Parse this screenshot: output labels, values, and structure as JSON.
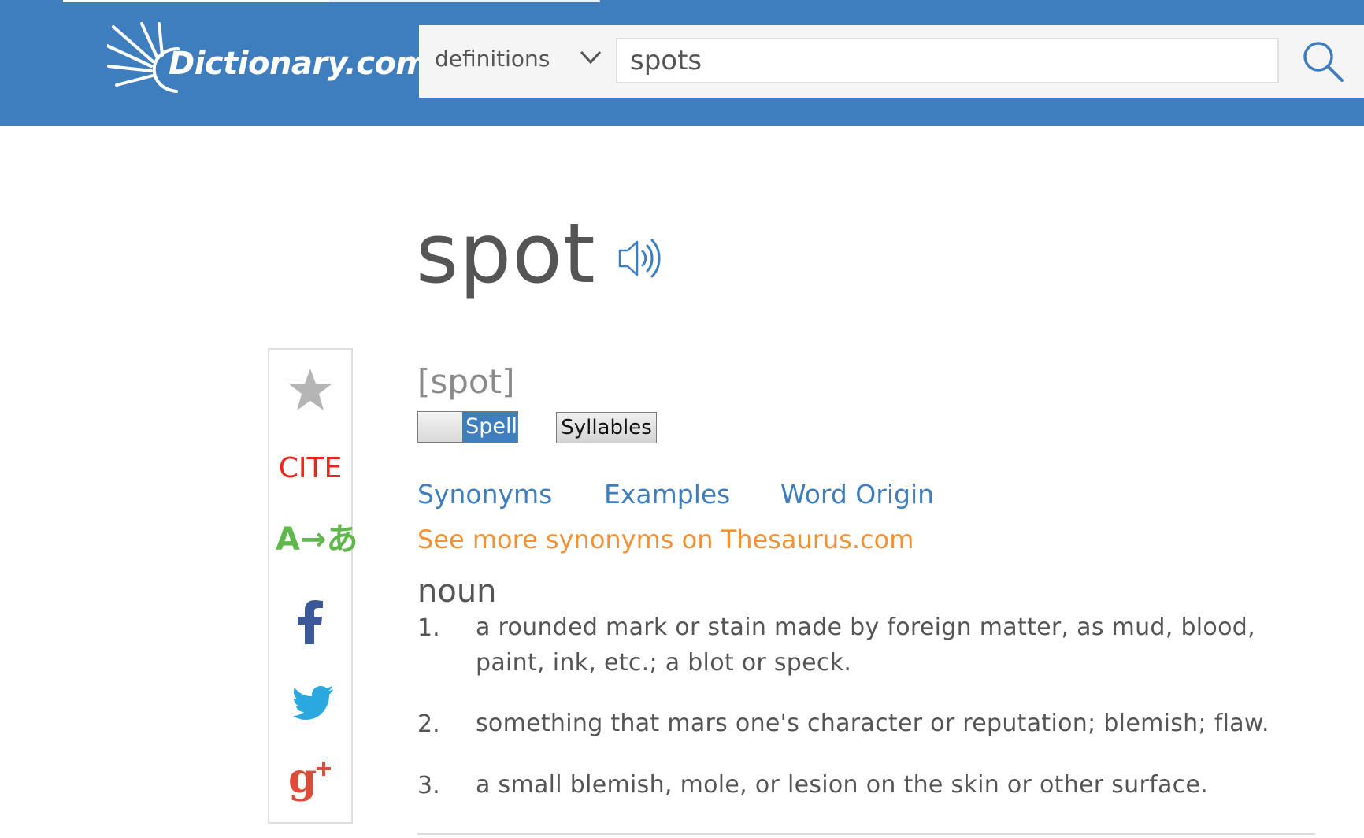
{
  "header": {
    "logo_text": "Dictionary.com",
    "search_type": "definitions",
    "search_value": "spots",
    "search_icon": "search-icon",
    "brand_color": "#3f7ebe"
  },
  "entry": {
    "headword": "spot",
    "audio_icon": "speaker-icon",
    "pronunciation": "[spot]",
    "spell_label": "Spell",
    "syllables_label": "Syllables"
  },
  "sidebar": {
    "favorite_icon": "star-icon",
    "cite_label": "CITE",
    "translate_label": "A→あ",
    "facebook_icon": "facebook-icon",
    "twitter_icon": "twitter-icon",
    "gplus_icon": "google-plus-icon"
  },
  "links": {
    "synonyms": "Synonyms",
    "examples": "Examples",
    "word_origin": "Word Origin",
    "thesaurus": "See more synonyms on Thesaurus.com"
  },
  "definitions": {
    "part_of_speech": "noun",
    "items": [
      {
        "num": "1.",
        "text": "a rounded mark or stain made by foreign matter, as mud, blood, paint, ink, etc.; a blot or speck."
      },
      {
        "num": "2.",
        "text": "something that mars one's character or reputation; blemish; flaw."
      },
      {
        "num": "3.",
        "text": "a small blemish, mole, or lesion on the skin or other surface."
      }
    ]
  }
}
